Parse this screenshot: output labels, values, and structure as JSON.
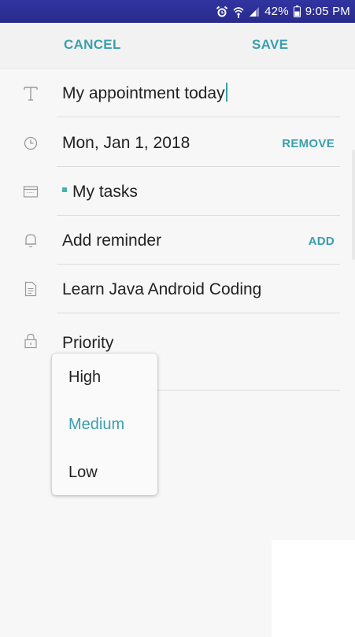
{
  "status_bar": {
    "battery": "42%",
    "time": "9:05 PM"
  },
  "action_bar": {
    "cancel_label": "CANCEL",
    "save_label": "SAVE"
  },
  "form": {
    "title_value": "My appointment today",
    "date": "Mon, Jan 1, 2018",
    "remove_label": "REMOVE",
    "task_list": "My tasks",
    "reminder": "Add reminder",
    "add_label": "ADD",
    "notes": "Learn Java Android Coding",
    "priority_label": "Priority"
  },
  "priority_dropdown": {
    "options": [
      "High",
      "Medium",
      "Low"
    ],
    "selected": "Medium"
  },
  "colors": {
    "accent": "#3a9fae",
    "status_bar": "#2e3192",
    "task_color": "#3fb6b0"
  },
  "icons": {
    "title": "text-t-icon",
    "date": "clock-icon",
    "task_list": "calendar-icon",
    "reminder": "bell-icon",
    "notes": "document-icon",
    "priority": "lock-icon"
  }
}
